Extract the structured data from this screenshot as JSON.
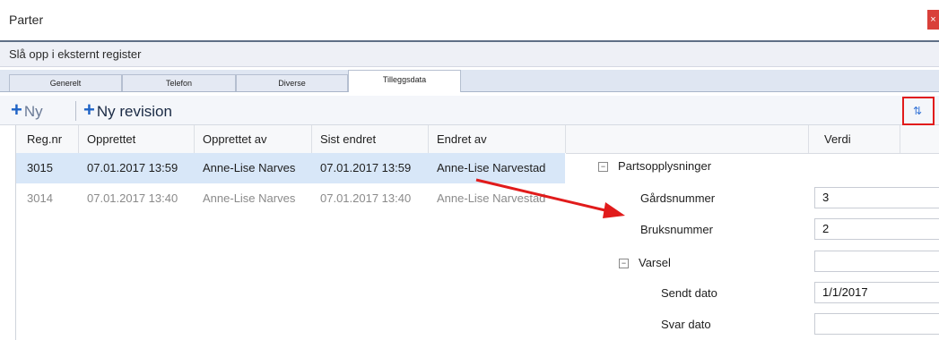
{
  "window": {
    "title": "Parter",
    "close_label": "×"
  },
  "lookup_label": "Slå opp i eksternt register",
  "tabs": [
    {
      "label": "Generelt"
    },
    {
      "label": "Telefon"
    },
    {
      "label": "Diverse"
    },
    {
      "label": "Tilleggsdata"
    }
  ],
  "toolbar": {
    "new_label": "Ny",
    "new_revision_label": "Ny revision"
  },
  "grid": {
    "columns": [
      "Reg.nr",
      "Opprettet",
      "Opprettet av",
      "Sist endret",
      "Endret av"
    ],
    "rows": [
      {
        "reg": "3015",
        "created": "07.01.2017 13:59",
        "created_by": "Anne-Lise Narves",
        "modified": "07.01.2017 13:59",
        "modified_by": "Anne-Lise Narvestad"
      },
      {
        "reg": "3014",
        "created": "07.01.2017 13:40",
        "created_by": "Anne-Lise Narves",
        "modified": "07.01.2017 13:40",
        "modified_by": "Anne-Lise Narvestad"
      }
    ]
  },
  "properties": {
    "value_header": "Verdi",
    "group": "Partsopplysninger",
    "gardsnummer_label": "Gårdsnummer",
    "gardsnummer_value": "3",
    "bruksnummer_label": "Bruksnummer",
    "bruksnummer_value": "2",
    "varsel_label": "Varsel",
    "sendt_dato_label": "Sendt dato",
    "sendt_dato_value": "1/1/2017",
    "svar_dato_label": "Svar dato"
  },
  "colors": {
    "accent": "#1e63c6",
    "highlight_red": "#e11b1b",
    "selection": "#d8e7f8"
  },
  "icons": {
    "plus": "plus-icon",
    "layout": "layout-toggle-icon",
    "close": "close-icon",
    "expand": "collapse-icon"
  }
}
